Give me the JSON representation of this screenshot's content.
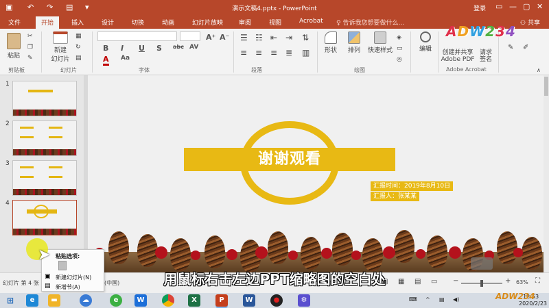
{
  "titlebar": {
    "document_title": "演示文稿4.pptx - PowerPoint",
    "login": "登录"
  },
  "tabs": [
    "文件",
    "开始",
    "插入",
    "设计",
    "切换",
    "动画",
    "幻灯片放映",
    "审阅",
    "视图",
    "Acrobat"
  ],
  "active_tab": "开始",
  "tell_me": "告诉我您想要做什么...",
  "share": "共享",
  "ribbon": {
    "paste": "粘贴",
    "new_slide_line1": "新建",
    "new_slide_line2": "幻灯片",
    "shape": "形状",
    "arrange": "排列",
    "quick_styles": "快速样式",
    "edit": "编辑",
    "create_share_line1": "创建并共享",
    "create_share_line2": "Adobe PDF",
    "request_sign_line1": "请求",
    "request_sign_line2": "签名",
    "groups": {
      "clipboard": "剪贴板",
      "slides": "幻灯片",
      "font": "字体",
      "paragraph": "段落",
      "drawing": "绘图",
      "acrobat": "Adobe Acrobat"
    },
    "format_buttons": [
      "B",
      "I",
      "U",
      "S",
      "abc",
      "AV",
      "Aa",
      "A"
    ]
  },
  "thumbnails": [
    {
      "number": "1"
    },
    {
      "number": "2"
    },
    {
      "number": "3"
    },
    {
      "number": "4"
    }
  ],
  "slide": {
    "title": "谢谢观看",
    "report_time": "汇报时间：2019年8月10日",
    "reporter": "汇报人：张某某"
  },
  "context_menu": {
    "header": "粘贴选项:",
    "new_slide": "新建幻灯片(N)",
    "new_section": "新增节(A)"
  },
  "status": {
    "slide_info": "幻灯片 第 4 张",
    "lang_fragment": "(中国)",
    "notes": "备注",
    "comments": "批注",
    "zoom": "63%"
  },
  "subtitle": "用鼠标右击左边PPT缩略图的空白处",
  "watermark": "ADW234",
  "taskbar": {
    "time": "12:53",
    "date": "2020/2/23"
  },
  "colors": {
    "accent": "#b7472a",
    "slide_yellow": "#e8b914"
  }
}
